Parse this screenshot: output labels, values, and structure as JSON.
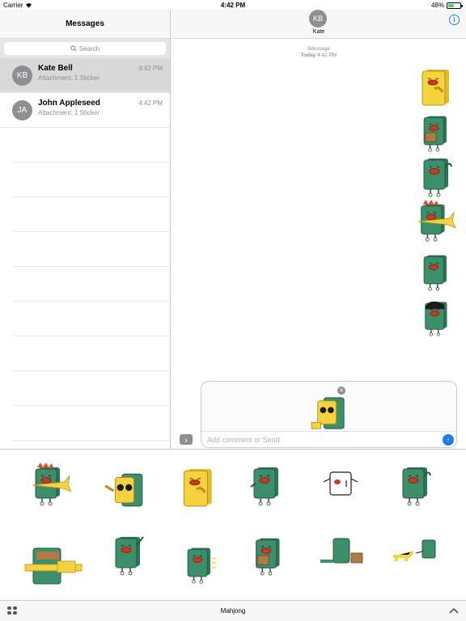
{
  "status_bar": {
    "carrier": "Carrier",
    "time": "4:42 PM",
    "battery": "48%",
    "battery_level": 0.48
  },
  "sidebar": {
    "title": "Messages",
    "search_placeholder": "Search",
    "conversations": [
      {
        "initials": "KB",
        "name": "Kate Bell",
        "time": "4:42 PM",
        "preview": "Attachment: 1 Sticker",
        "selected": true
      },
      {
        "initials": "JA",
        "name": "John Appleseed",
        "time": "4:42 PM",
        "preview": "Attachment: 1 Sticker",
        "selected": false
      }
    ]
  },
  "conversation": {
    "contact_initials": "KB",
    "contact_name": "Kate",
    "service": "iMessage",
    "day": "Today",
    "time": "4:42 PM"
  },
  "compose": {
    "placeholder": "Add comment or Send"
  },
  "app_drawer": {
    "app_name": "Mahjong"
  },
  "colors": {
    "tile_green": "#3d8f6b",
    "tile_yellow": "#f5d33f",
    "mouth": "#c93a1e",
    "hair": "#e8481f",
    "accent_blue": "#1a7cf5"
  }
}
